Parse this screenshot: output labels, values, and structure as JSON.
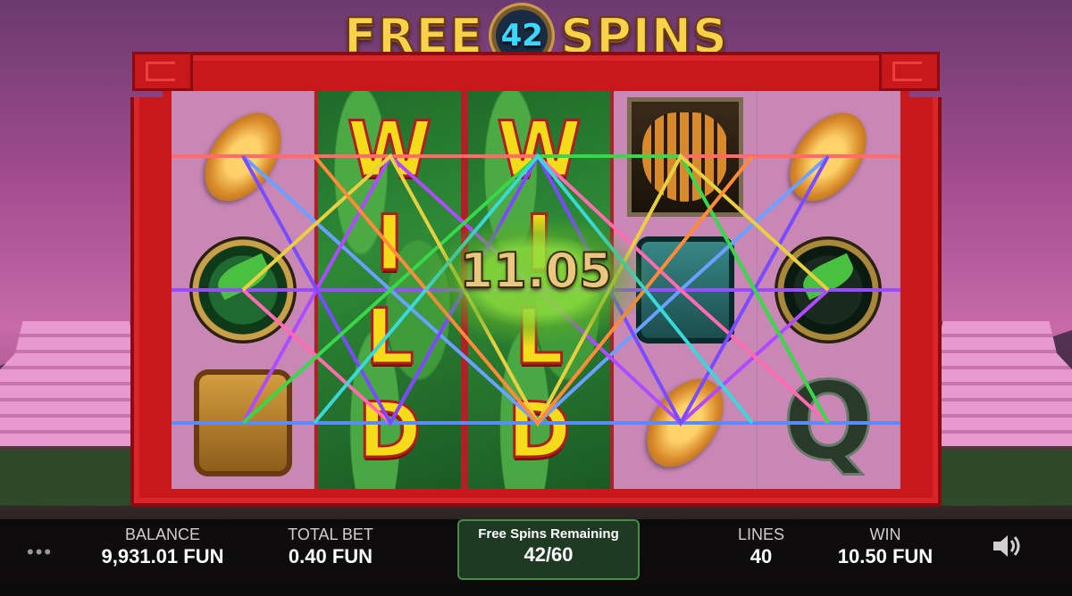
{
  "title": {
    "left_word": "FREE",
    "badge_number": "42",
    "right_word": "SPINS"
  },
  "reels": {
    "wild_letters": [
      "W",
      "I",
      "L",
      "D"
    ],
    "columns": [
      {
        "symbols": [
          "gold-coin",
          "green-leaf-medal",
          "golden-mask"
        ]
      },
      {
        "symbols": [
          "wild"
        ]
      },
      {
        "symbols": [
          "wild"
        ]
      },
      {
        "symbols": [
          "tiger",
          "jade-mask",
          "gold-coin"
        ]
      },
      {
        "symbols": [
          "gold-coin",
          "dark-leaf-medal",
          "letter-q"
        ]
      }
    ],
    "q_letter": "Q"
  },
  "win_overlay": {
    "amount": "11.05"
  },
  "bottom_bar": {
    "menu_label": "•••",
    "balance_label": "BALANCE",
    "balance_value": "9,931.01 FUN",
    "total_bet_label": "TOTAL BET",
    "total_bet_value": "0.40 FUN",
    "free_spins_label": "Free Spins Remaining",
    "free_spins_value": "42/60",
    "lines_label": "LINES",
    "lines_value": "40",
    "win_label": "WIN",
    "win_value": "10.50 FUN",
    "sound_icon": "speaker-icon"
  },
  "colors": {
    "frame": "#c9181c",
    "title_gold": "#f7d24a",
    "badge_number": "#3ad8ff",
    "free_box_bg": "#1f3a22"
  }
}
